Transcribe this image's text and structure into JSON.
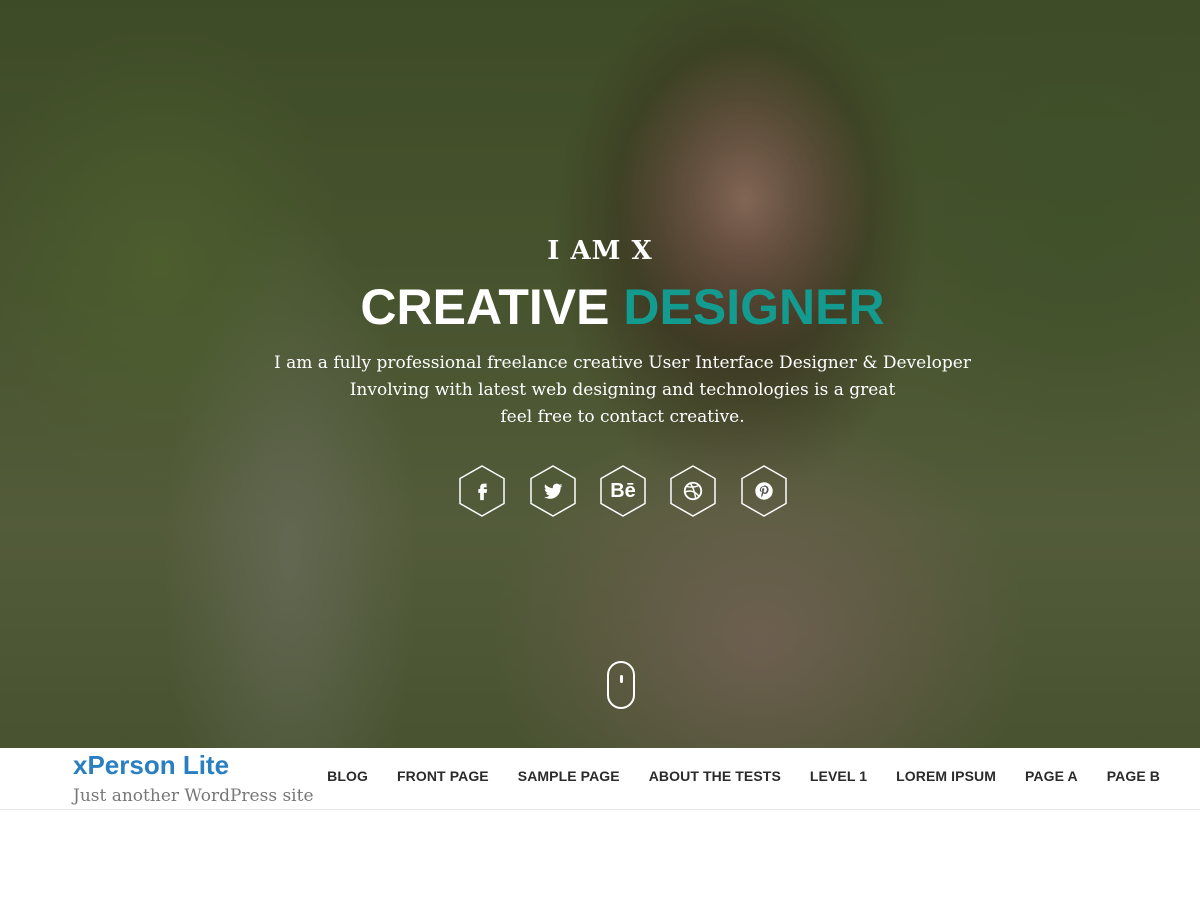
{
  "hero": {
    "pretitle": "I AM X",
    "title_part1": "CREATIVE",
    "title_part2": "DESIGNER",
    "description_lines": [
      "I am a fully professional freelance creative User Interface Designer & Developer",
      "Involving with latest web designing and technologies is a great",
      "feel free to contact creative."
    ],
    "social": [
      {
        "name": "facebook",
        "glyph": "f"
      },
      {
        "name": "twitter",
        "glyph": "t"
      },
      {
        "name": "behance",
        "glyph": "Bē"
      },
      {
        "name": "dribbble",
        "glyph": "◎"
      },
      {
        "name": "pinterest",
        "glyph": "p"
      }
    ],
    "accent_color": "#139b8f"
  },
  "header": {
    "site_title": "xPerson Lite",
    "tagline": "Just another WordPress site",
    "nav": [
      "BLOG",
      "FRONT PAGE",
      "SAMPLE PAGE",
      "ABOUT THE TESTS",
      "LEVEL 1",
      "LOREM IPSUM",
      "PAGE A",
      "PAGE B"
    ],
    "title_color": "#2a7fc0"
  }
}
